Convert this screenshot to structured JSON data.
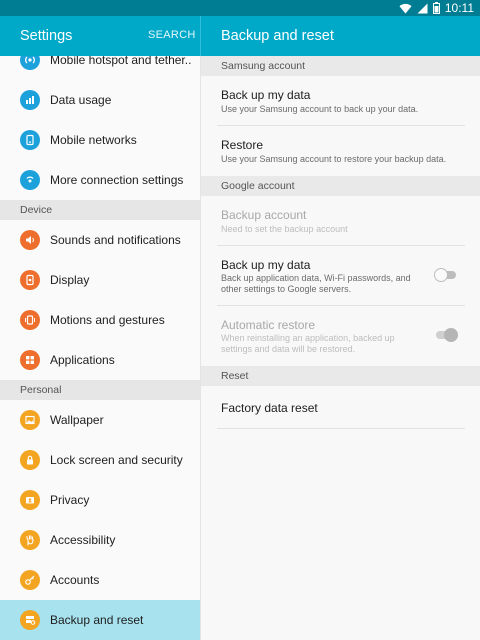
{
  "status_bar": {
    "time": "10:11"
  },
  "left_pane": {
    "title": "Settings",
    "search_label": "SEARCH",
    "items": [
      {
        "label": "Mobile hotspot and tether.."
      },
      {
        "label": "Data usage"
      },
      {
        "label": "Mobile networks"
      },
      {
        "label": "More connection settings"
      },
      {
        "label": "Sounds and notifications"
      },
      {
        "label": "Display"
      },
      {
        "label": "Motions and gestures"
      },
      {
        "label": "Applications"
      },
      {
        "label": "Wallpaper"
      },
      {
        "label": "Lock screen and security"
      },
      {
        "label": "Privacy"
      },
      {
        "label": "Accessibility"
      },
      {
        "label": "Accounts"
      },
      {
        "label": "Backup and reset",
        "selected": true
      }
    ],
    "sections": {
      "device": "Device",
      "personal": "Personal"
    },
    "icons": [
      "hotspot-icon",
      "data-usage-icon",
      "mobile-networks-icon",
      "more-connections-icon",
      "sound-icon",
      "display-icon",
      "motion-icon",
      "applications-icon",
      "wallpaper-icon",
      "lock-icon",
      "privacy-icon",
      "accessibility-icon",
      "accounts-icon",
      "backup-icon"
    ]
  },
  "right_pane": {
    "title": "Backup and reset",
    "sections": {
      "samsung": "Samsung account",
      "google": "Google account",
      "reset": "Reset"
    },
    "samsung_backup": {
      "title": "Back up my data",
      "subtitle": "Use your Samsung account to back up your data."
    },
    "samsung_restore": {
      "title": "Restore",
      "subtitle": "Use your Samsung account to restore your backup data."
    },
    "google_backup_account": {
      "title": "Backup account",
      "subtitle": "Need to set the backup account",
      "enabled": false
    },
    "google_backup": {
      "title": "Back up my data",
      "subtitle": "Back up application data, Wi-Fi passwords, and other settings to Google servers.",
      "toggle": "off"
    },
    "auto_restore": {
      "title": "Automatic restore",
      "subtitle": "When reinstalling an application, backed up settings and data will be restored.",
      "toggle": "on",
      "enabled": false
    },
    "factory_reset": {
      "title": "Factory data reset"
    }
  },
  "colors": {
    "app_bar": "#01a9c9",
    "status_bar": "#007d93",
    "selected_row": "#a7e2ee",
    "icon_blue": "#1da1db",
    "icon_orange": "#ee6f2d",
    "icon_amber": "#f3a421"
  }
}
